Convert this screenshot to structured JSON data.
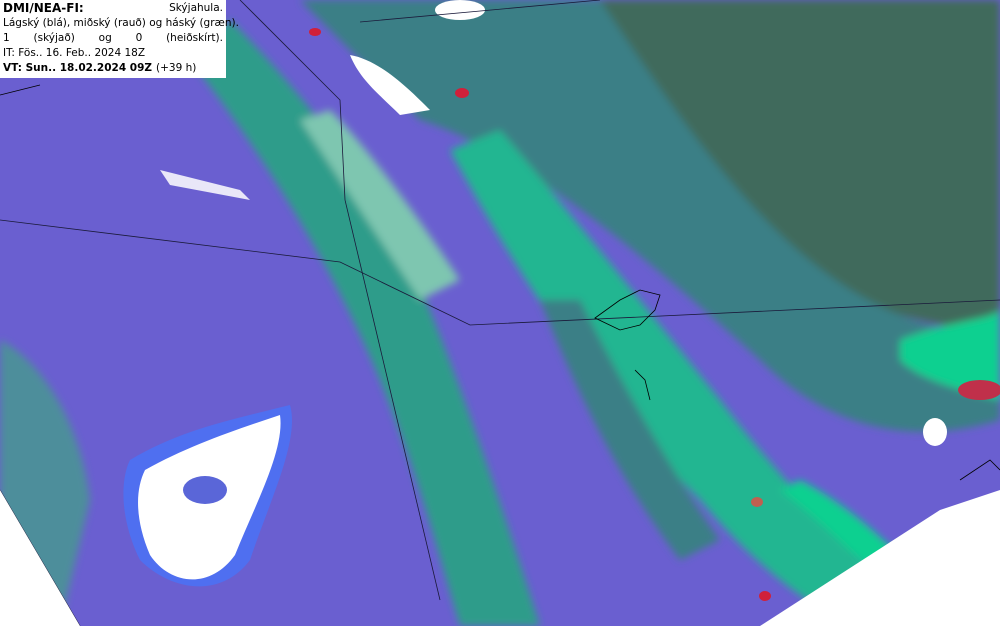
{
  "legend": {
    "source": "DMI/NEA-FI:",
    "parameter": "Skýjahula.",
    "layers": "Lágský (blá), miðský (rauð) og háský (græn).",
    "scale_high_value": "1",
    "scale_high_label": "(skýjað)",
    "scale_and": "og",
    "scale_low_value": "0",
    "scale_low_label": "(heiðskírt).",
    "initial_time": "IT: Fös.. 16. Feb.. 2024 18Z",
    "valid_time": "VT: Sun.. 18.02.2024 09Z",
    "lead_time": "(+39 h)"
  },
  "colors": {
    "low_cloud": "#6a5fd0",
    "mid_cloud": "#d0203a",
    "high_cloud": "#10d090",
    "dense_cloud": "#3a7f86",
    "overcast_land": "#3f6a5c",
    "clear": "#ffffff"
  }
}
